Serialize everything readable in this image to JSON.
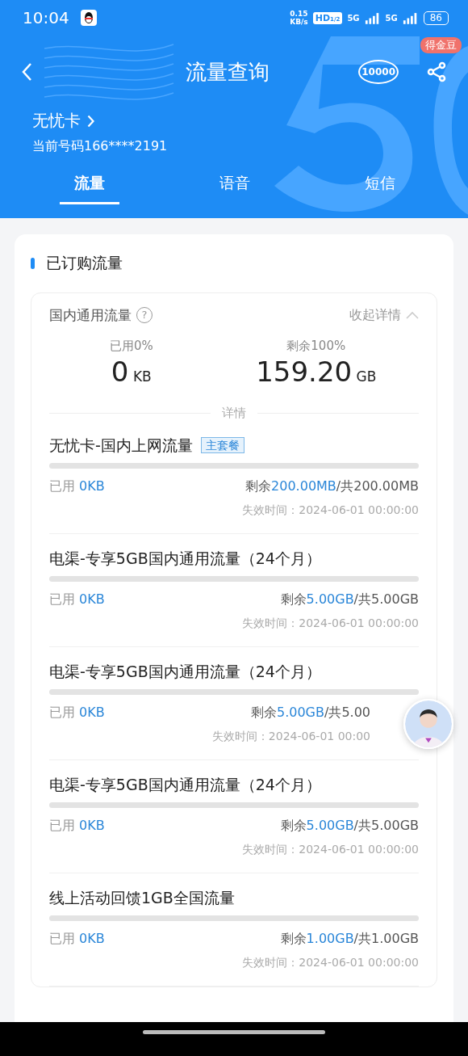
{
  "status_bar": {
    "time": "10:04",
    "speed_value": "0.15",
    "speed_unit": "KB/s",
    "hd": "HD",
    "hd_sub": "1/2",
    "networks": [
      "5G",
      "5G"
    ],
    "battery": "86"
  },
  "nav": {
    "title": "流量查询",
    "service_label": "10000",
    "badge": "得金豆"
  },
  "card": {
    "name": "无忧卡",
    "number": "当前号码166****2191"
  },
  "tabs": [
    {
      "label": "流量",
      "selected": true
    },
    {
      "label": "语音",
      "selected": false
    },
    {
      "label": "短信",
      "selected": false
    }
  ],
  "section": {
    "title": "已订购流量"
  },
  "summary": {
    "title": "国内通用流量",
    "help": "?",
    "toggle": "收起详情",
    "expanded": true,
    "used_label": "已用0%",
    "used_value": "0",
    "used_unit": "KB",
    "left_label": "剩余100%",
    "left_value": "159.20",
    "left_unit": "GB",
    "details_label": "详情"
  },
  "items": [
    {
      "title": "无忧卡-国内上网流量",
      "tag": "主套餐",
      "level": 0,
      "used_label": "已用",
      "used": "0KB",
      "left_label": "剩余",
      "left": "200.00MB",
      "total": "/共200.00MB",
      "expiry": "失效时间：2024-06-01 00:00:00",
      "covered": false
    },
    {
      "title": "电渠-专享5GB国内通用流量（24个月）",
      "level": 0,
      "used_label": "已用",
      "used": "0KB",
      "left_label": "剩余",
      "left": "5.00GB",
      "total": "/共5.00GB",
      "expiry": "失效时间：2024-06-01 00:00:00",
      "covered": false
    },
    {
      "title": "电渠-专享5GB国内通用流量（24个月）",
      "level": 0,
      "used_label": "已用",
      "used": "0KB",
      "left_label": "剩余",
      "left": "5.00GB",
      "total": "/共5.00",
      "expiry": "失效时间：2024-06-01 00:00",
      "covered": true
    },
    {
      "title": "电渠-专享5GB国内通用流量（24个月）",
      "level": 0,
      "used_label": "已用",
      "used": "0KB",
      "left_label": "剩余",
      "left": "5.00GB",
      "total": "/共5.00GB",
      "expiry": "失效时间：2024-06-01 00:00:00",
      "covered": false
    },
    {
      "title": "线上活动回馈1GB全国流量",
      "level": 0,
      "used_label": "已用",
      "used": "0KB",
      "left_label": "剩余",
      "left": "1.00GB",
      "total": "/共1.00GB",
      "expiry": "失效时间：2024-06-01 00:00:00",
      "covered": false
    }
  ]
}
